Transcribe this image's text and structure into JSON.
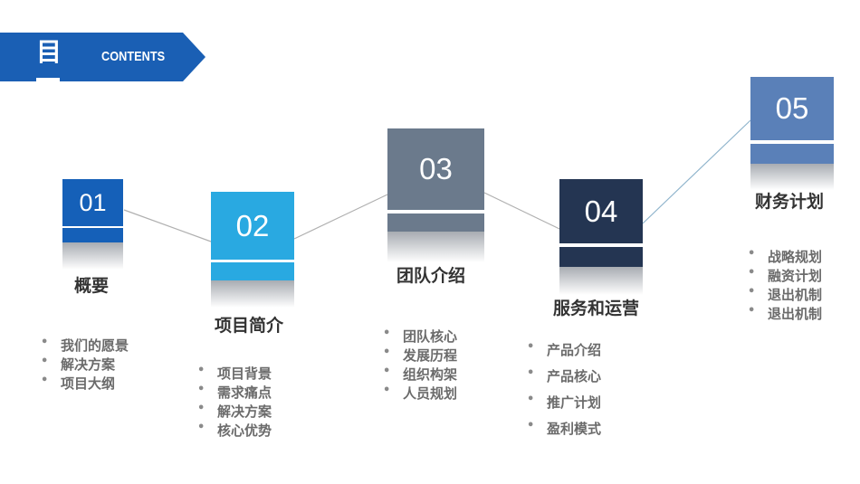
{
  "header": {
    "title_char": "目",
    "contents_label": "CONTENTS",
    "color": "#1a5fb4"
  },
  "sections": [
    {
      "number": "01",
      "title": "概要",
      "color": "#1560b8",
      "items": [
        "我们的愿景",
        "解决方案",
        "项目大纲"
      ]
    },
    {
      "number": "02",
      "title": "项目简介",
      "color": "#29a9e1",
      "items": [
        "项目背景",
        "需求痛点",
        "解决方案",
        "核心优势"
      ]
    },
    {
      "number": "03",
      "title": "团队介绍",
      "color": "#6b7a8c",
      "items": [
        "团队核心",
        "发展历程",
        "组织构架",
        "人员规划"
      ]
    },
    {
      "number": "04",
      "title": "服务和运营",
      "color": "#243552",
      "items": [
        "产品介绍",
        "产品核心",
        "推广计划",
        "盈利模式"
      ]
    },
    {
      "number": "05",
      "title": "财务计划",
      "color": "#5a80b8",
      "items": [
        "战略规划",
        "融资计划",
        "退出机制",
        "退出机制"
      ]
    }
  ],
  "connector_colors": {
    "default": "#b0b0b0",
    "last": "#8fb4cc"
  }
}
